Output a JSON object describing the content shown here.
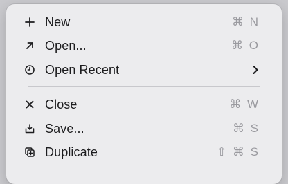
{
  "menu": {
    "items": [
      {
        "icon": "plus-icon",
        "label": "New",
        "shortcut": "⌘ N"
      },
      {
        "icon": "arrow-up-right-icon",
        "label": "Open...",
        "shortcut": "⌘ O"
      },
      {
        "icon": "clock-icon",
        "label": "Open Recent",
        "submenu": "chevron-right-icon"
      },
      {
        "icon": "close-x-icon",
        "label": "Close",
        "shortcut": "⌘ W"
      },
      {
        "icon": "save-icon",
        "label": "Save...",
        "shortcut": "⌘ S"
      },
      {
        "icon": "duplicate-icon",
        "label": "Duplicate",
        "shortcut": "⇧ ⌘ S"
      }
    ]
  },
  "colors": {
    "background": "#c9c9cd",
    "menu_background": "#ececee",
    "text": "#1d1d1f",
    "shortcut_text": "#9a9a9f",
    "separator": "#c8c8cc"
  }
}
